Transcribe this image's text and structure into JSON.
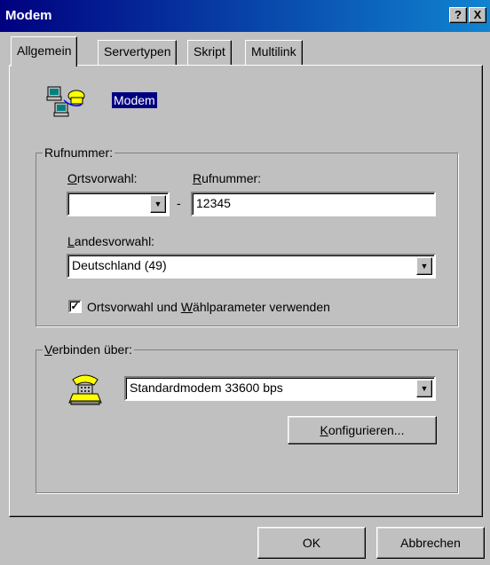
{
  "window": {
    "title": "Modem",
    "help_button": "?",
    "close_button": "X"
  },
  "tabs": [
    {
      "label": "Allgemein",
      "active": true
    },
    {
      "label": "Servertypen",
      "active": false
    },
    {
      "label": "Skript",
      "active": false
    },
    {
      "label": "Multilink",
      "active": false
    }
  ],
  "connection_name": "Modem",
  "rufnummer_group": {
    "title": "Rufnummer:",
    "ortsvorwahl_label_underlined": "O",
    "ortsvorwahl_label_rest": "rtsvorwahl:",
    "ortsvorwahl_value": "",
    "separator": "-",
    "rufnummer_label_underlined": "R",
    "rufnummer_label_rest": "ufnummer:",
    "rufnummer_value": "12345",
    "landesvorwahl_label_underlined": "L",
    "landesvorwahl_label_rest": "andesvorwahl:",
    "landesvorwahl_value": "Deutschland (49)",
    "checkbox_checked": true,
    "checkbox_label_before": "Ortsvorwahl und ",
    "checkbox_label_underlined": "W",
    "checkbox_label_after": "ählparameter verwenden"
  },
  "verbinden_group": {
    "title_underlined": "V",
    "title_rest": "erbinden über:",
    "device_value": "Standardmodem 33600 bps",
    "configure_underlined": "K",
    "configure_rest": "onfigurieren..."
  },
  "footer": {
    "ok_label": "OK",
    "cancel_label": "Abbrechen"
  },
  "icons": {
    "connection": "dialup-computer-icon",
    "modem": "modem-phone-icon"
  }
}
